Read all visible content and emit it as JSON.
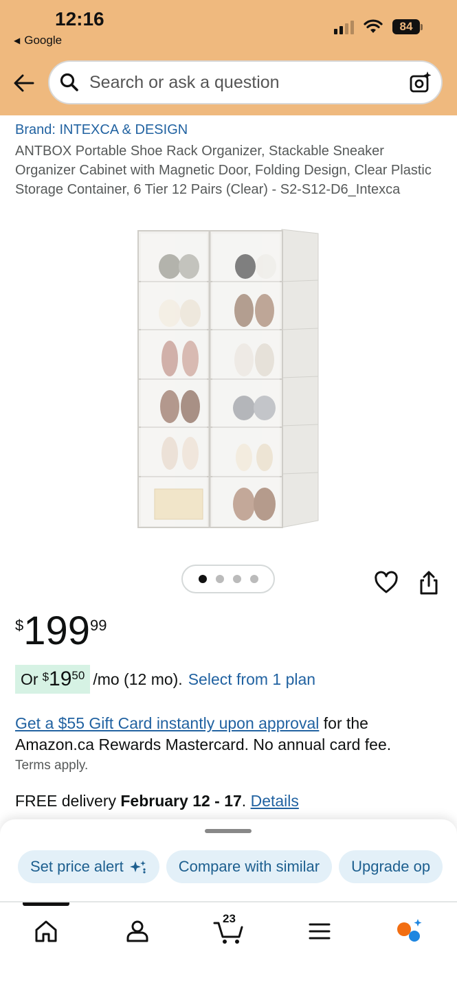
{
  "status_bar": {
    "time": "12:16",
    "back_app": "Google",
    "battery": "84"
  },
  "search": {
    "placeholder": "Search or ask a question"
  },
  "product": {
    "brand": "Brand: INTEXCA & DESIGN",
    "title": "ANTBOX Portable Shoe Rack Organizer, Stackable Sneaker Organizer Cabinet with Magnetic Door, Folding Design, Clear Plastic Storage Container, 6 Tier 12 Pairs (Clear) - S2-S12-D6_Intexca",
    "image_count": 4,
    "active_image": 1
  },
  "price": {
    "symbol": "$",
    "whole": "199",
    "fraction": "99"
  },
  "monthly": {
    "prefix": "Or",
    "symbol": "$",
    "whole": "19",
    "fraction": "50",
    "term": "/mo (12 mo).",
    "plan_link": "Select from 1 plan"
  },
  "gift_card": {
    "link": "Get a $55 Gift Card instantly upon approval",
    "text": " for the Amazon.ca Rewards Mastercard. No annual card fee.",
    "terms": "Terms apply."
  },
  "delivery": {
    "prefix": "FREE delivery ",
    "dates": "February 12 - 17",
    "sep": ". ",
    "link": "Details"
  },
  "chips": [
    {
      "label": "Set price alert"
    },
    {
      "label": "Compare with similar"
    },
    {
      "label": "Upgrade op"
    }
  ],
  "nav": {
    "cart_count": "23"
  },
  "colors": {
    "header": "#efb97e",
    "link": "#2162a1",
    "monthly_highlight": "#d6f2e4",
    "chip_bg": "#e3f0f8"
  }
}
